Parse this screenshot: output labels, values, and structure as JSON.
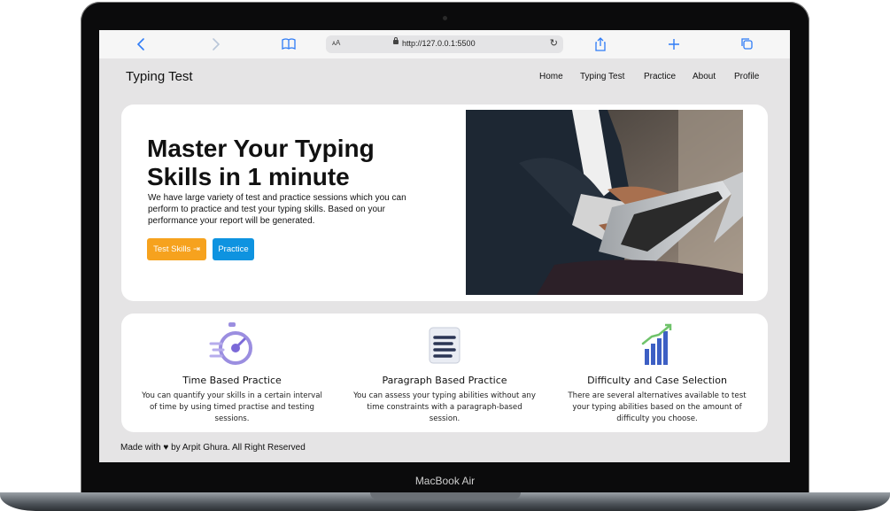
{
  "device": {
    "label": "MacBook Air"
  },
  "browser": {
    "url_prefix": "ᴀA",
    "url": "http://127.0.0.1:5500",
    "icons": [
      "back-icon",
      "forward-icon",
      "bookmarks-icon",
      "reload-icon",
      "share-icon",
      "new-tab-icon",
      "tabs-icon"
    ]
  },
  "site": {
    "brand": "Typing Test",
    "nav": [
      "Home",
      "Typing Test",
      "Practice",
      "About",
      "Profile"
    ]
  },
  "hero": {
    "title": "Master Your Typing Skills in 1 minute",
    "description": "We have large variety of test and practice sessions which you can perform to practice and test your typing skills. Based on your performance your report will be generated.",
    "primary_button": "Test Skills ⇥",
    "secondary_button": "Practice",
    "colors": {
      "primary": "#f6a21e",
      "secondary": "#0e93e0"
    }
  },
  "features": [
    {
      "title": "Time Based Practice",
      "description": "You can quantify your skills in a certain interval of time by using timed practise and testing sessions.",
      "icon": "stopwatch-icon"
    },
    {
      "title": "Paragraph Based Practice",
      "description": "You can assess your typing abilities without any time constraints with a paragraph-based session.",
      "icon": "paragraph-icon"
    },
    {
      "title": "Difficulty and Case Selection",
      "description": "There are several alternatives available to test your typing abilities based on the amount of difficulty you choose.",
      "icon": "growth-chart-icon"
    }
  ],
  "footer": {
    "text": "Made with ♥ by Arpit Ghura. All Right Reserved"
  }
}
